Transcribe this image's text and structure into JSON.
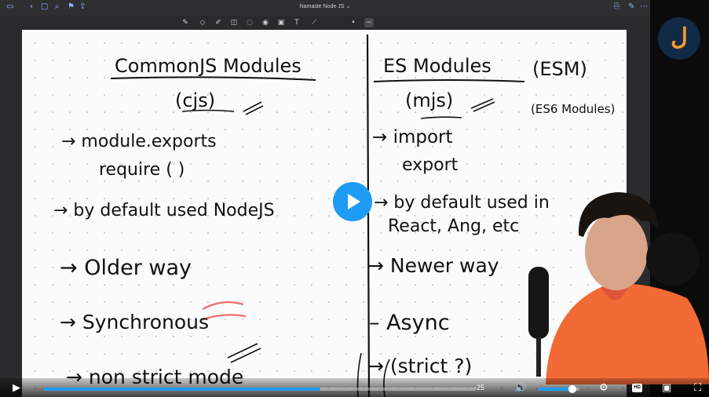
{
  "app": {
    "title": "Namaste Node JS",
    "title_suffix": "⌄"
  },
  "colors": {
    "accent": "#1e9cf5",
    "logo_bg": "#122a45",
    "logo_fg": "#f39a2b",
    "shirt": "#f26a35",
    "ink": "#111111"
  },
  "toolbar_icons": [
    "pen-icon",
    "eraser-icon",
    "highlighter-icon",
    "shapes-icon",
    "lasso-icon",
    "sticker-icon",
    "image-icon",
    "text-icon",
    "laser-icon",
    "dot-icon",
    "wave-icon"
  ],
  "notes": {
    "left_title": "CommonJS Modules",
    "left_sub": "(cjs)",
    "left_items": [
      "→ module.exports",
      "require ( )",
      "→ by default used NodeJS",
      "→ Older way",
      "→ Synchronous",
      "→ non strict mode"
    ],
    "right_title": "ES Modules",
    "right_title_extra": "(ESM)",
    "right_sub": "(mjs)",
    "right_note": "(ES6 Modules)",
    "right_items": [
      "→ import",
      "export",
      "→ by default used in",
      "React, Ang, etc",
      "→ Newer way",
      "– Async",
      "→ (strict ?)"
    ]
  },
  "player": {
    "progress": 0.64,
    "buffered": 0.55,
    "volume": 0.82,
    "time": "-25",
    "hd_label": "HD"
  },
  "logo_glyph": "ل"
}
